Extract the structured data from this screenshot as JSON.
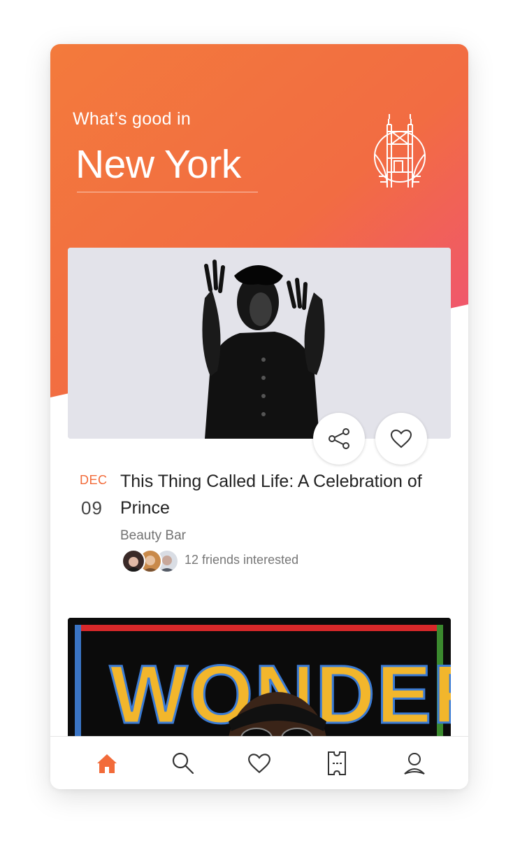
{
  "header": {
    "subtitle": "What’s good in",
    "city": "New York",
    "city_icon": "bridge-icon"
  },
  "events": [
    {
      "month": "DEC",
      "day": "09",
      "title": "This Thing Called Life: A Celebration of Prince",
      "venue": "Beauty Bar",
      "friends_interested": "12 friends interested",
      "actions": [
        "share-icon",
        "heart-icon"
      ]
    },
    {
      "image": "wonder-poster",
      "poster_text": "WONDER"
    }
  ],
  "tabbar": {
    "tabs": [
      {
        "name": "home",
        "icon": "home-icon",
        "active": true
      },
      {
        "name": "search",
        "icon": "search-icon",
        "active": false
      },
      {
        "name": "favorites",
        "icon": "heart-icon",
        "active": false
      },
      {
        "name": "tickets",
        "icon": "ticket-icon",
        "active": false
      },
      {
        "name": "profile",
        "icon": "user-icon",
        "active": false
      }
    ]
  },
  "colors": {
    "accent": "#f26b3a",
    "gradient_start": "#f37a3c",
    "gradient_end": "#f0577a",
    "text_dark": "#222222",
    "text_muted": "#777777"
  }
}
